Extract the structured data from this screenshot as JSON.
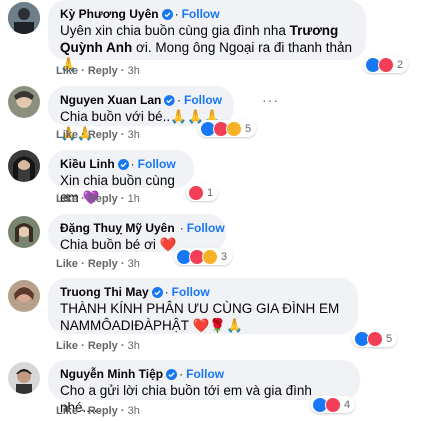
{
  "follow_label": "Follow",
  "like_label": "Like",
  "reply_label": "Reply",
  "separator": "·",
  "colors": {
    "link": "#1877f2",
    "bubble": "#f0f2f5",
    "like_blue": "#1877f2",
    "heart_red": "#f33e58",
    "sad_yellow": "#f7b125"
  },
  "comments": [
    {
      "name": "Kỳ Phương Uyên",
      "verified": true,
      "show_follow": true,
      "text_a": "Uyên xin chia buồn cùng gia đình nha ",
      "mention": "Trương Quỳnh Anh",
      "text_b": " ơi. Mong ông Ngoại ra đi thanh thản",
      "emoji": "🙏",
      "time": "3h",
      "reactions": [
        "like",
        "heart"
      ],
      "reaction_count": "2"
    },
    {
      "name": "Nguyen Xuan Lan",
      "verified": true,
      "show_follow": true,
      "text_a": "Chia buồn với bé..",
      "emoji": "🙏🙏🙏🙏🙏",
      "time": "3h",
      "reactions": [
        "like",
        "heart",
        "sad"
      ],
      "reaction_count": "5"
    },
    {
      "name": "Kiều Linh",
      "verified": true,
      "show_follow": true,
      "text_a": "Xin chia buồn cùng em ",
      "emoji": "💜",
      "time": "1h",
      "reactions": [
        "heart"
      ],
      "reaction_count": "1"
    },
    {
      "name": "Đặng Thuỵ Mỹ Uyên",
      "verified": true,
      "show_follow": true,
      "text_a": "Chia buồn bé ơi ",
      "emoji": "❤️",
      "time": "3h",
      "reactions": [
        "like",
        "heart",
        "sad"
      ],
      "reaction_count": "3"
    },
    {
      "name": "Truong Thi May",
      "verified": true,
      "show_follow": true,
      "text_a": "THÀNH KÍNH PHÂN ƯU CÙNG GIA ĐÌNH EM NAMMÔADIĐÀPHẬT ",
      "emoji": "❤️🌹🙏",
      "time": "3h",
      "reactions": [
        "like",
        "heart"
      ],
      "reaction_count": "5"
    },
    {
      "name": "Nguyễn Minh Tiệp",
      "verified": true,
      "show_follow": true,
      "text_a": "Cho a gửi lời chia buồn tới em và gia đình nhé.....",
      "emoji": "",
      "time": "3h",
      "reactions": [
        "like",
        "heart"
      ],
      "reaction_count": "4"
    }
  ]
}
